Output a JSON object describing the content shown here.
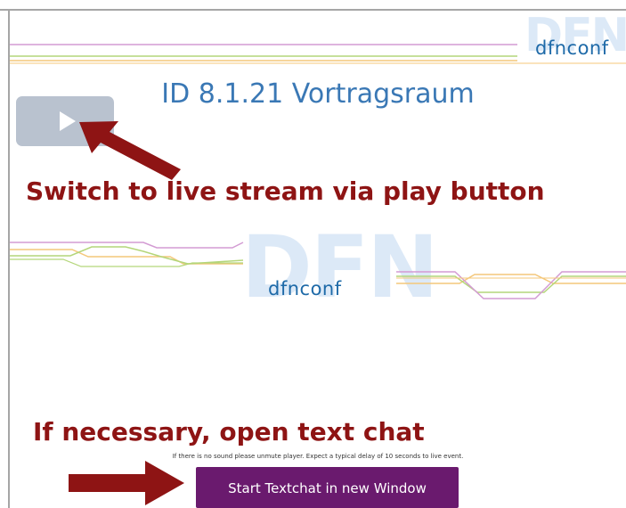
{
  "header": {
    "logo_ghost_text": "DFN",
    "logo_text": "dfnconf"
  },
  "room_title": "ID 8.1.21 Vortragsraum",
  "player": {
    "logo_ghost_text": "DFN",
    "logo_text": "dfnconf"
  },
  "annotations": {
    "play_hint": "Switch to live stream via play button",
    "chat_hint": "If necessary, open text chat"
  },
  "notice_text": "If there is no sound please unmute player. Expect a typical delay of 10 seconds to live event.",
  "chat_button_label": "Start Textchat in new Window",
  "colors": {
    "title": "#3a78b5",
    "annotation": "#8e1414",
    "chat_button": "#6a1a6e",
    "line_pink": "#d39bd3",
    "line_orange": "#f4c77a",
    "line_green": "#b4d67a"
  }
}
